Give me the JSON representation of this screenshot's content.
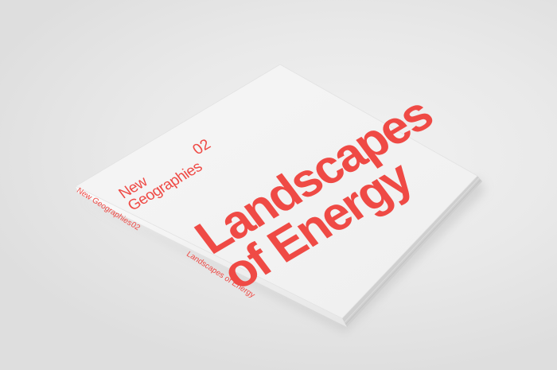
{
  "cover": {
    "series_line1": "New",
    "series_line2": "Geographies",
    "series_number": "02",
    "title_line1": "Landscapes",
    "title_line2": "of Energy"
  },
  "spine": {
    "series": "New Geographies",
    "number": "02",
    "title": "Landscapes of Energy"
  },
  "colors": {
    "accent_red": "#ef4a45",
    "cover_white": "#f7f7f7",
    "background": "#e8e8e8"
  }
}
